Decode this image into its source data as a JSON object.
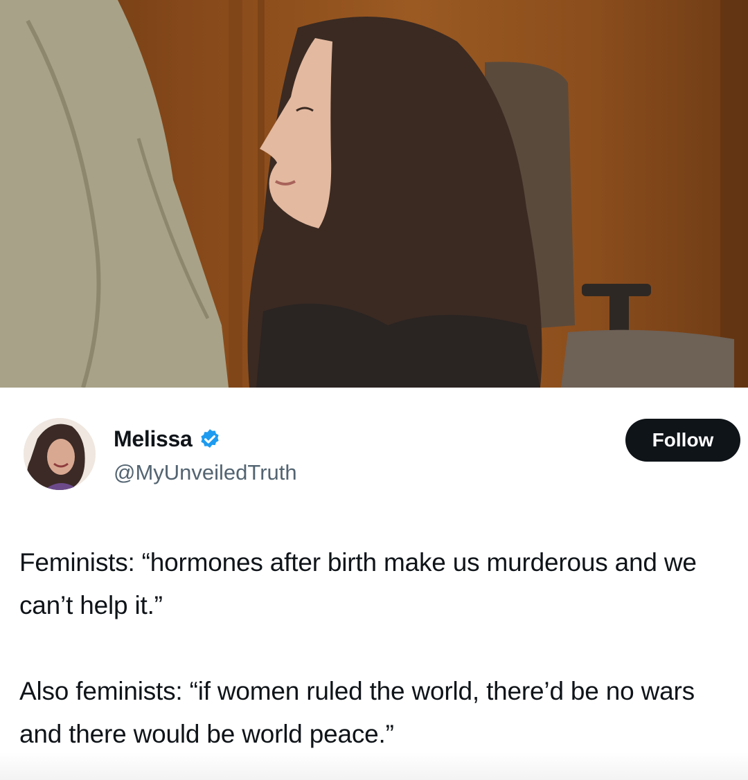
{
  "photo": {
    "description_icon": "photo"
  },
  "author": {
    "name": "Melissa",
    "handle": "@MyUnveiledTruth",
    "verified_icon": "verified-badge-icon",
    "verified_color": "#1d9bf0"
  },
  "follow_button": {
    "label": "Follow"
  },
  "tweet": {
    "paragraph_1": "Feminists: “hormones after birth make us murderous and we can’t help it.”",
    "paragraph_2": "Also feminists: “if women ruled the world, there’d be no wars and there would be world peace.”"
  },
  "colors": {
    "text": "#0f1419",
    "secondary": "#536471",
    "button_bg": "#0f1419"
  }
}
